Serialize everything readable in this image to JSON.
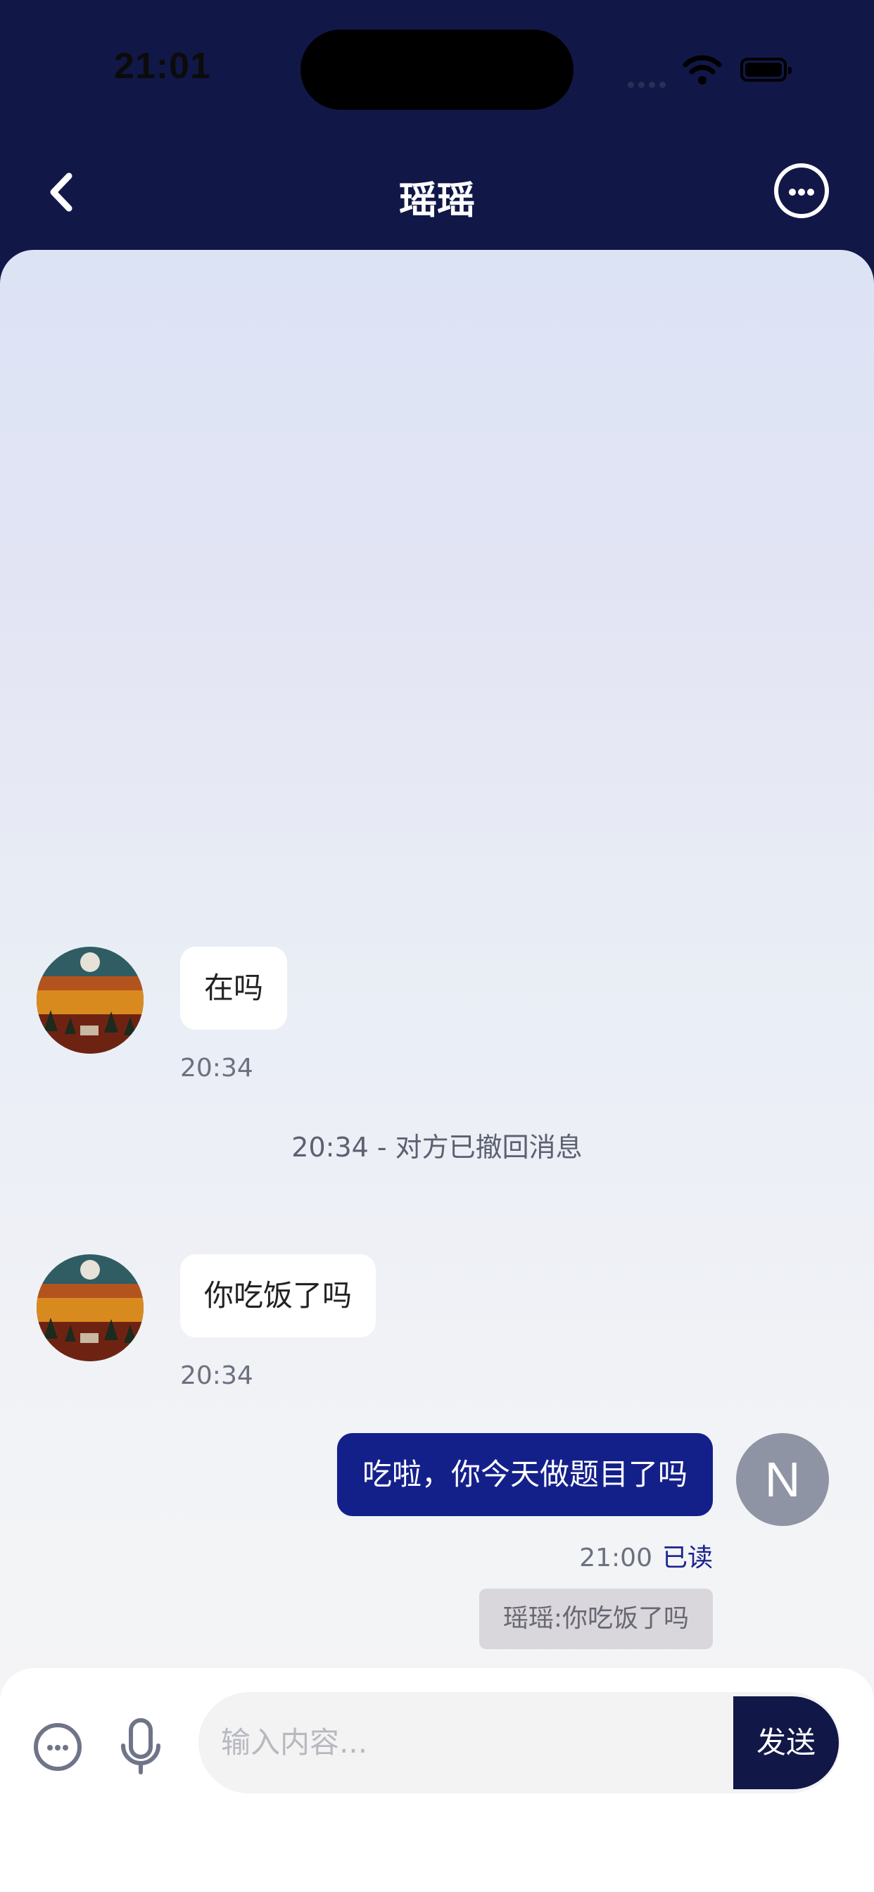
{
  "status_bar": {
    "time": "21:01"
  },
  "nav": {
    "title": "瑶瑶"
  },
  "messages": {
    "m1": {
      "text": "在吗",
      "time": "20:34"
    },
    "recall": {
      "text": "20:34 - 对方已撤回消息"
    },
    "m2": {
      "text": "你吃饭了吗",
      "time": "20:34"
    },
    "m3": {
      "text": "吃啦，你今天做题目了吗",
      "time": "21:00",
      "read": "已读",
      "quote": "瑶瑶:你吃饭了吗",
      "avatar_initial": "N"
    }
  },
  "input": {
    "placeholder": "输入内容...",
    "send_label": "发送"
  },
  "colors": {
    "header": "#111848",
    "outgoing_bubble": "#14208a",
    "incoming_bubble": "#ffffff",
    "read_status": "#1a2590"
  },
  "icons": [
    "back-icon",
    "more-icon",
    "wifi-icon",
    "battery-icon",
    "emoji-icon",
    "microphone-icon"
  ]
}
